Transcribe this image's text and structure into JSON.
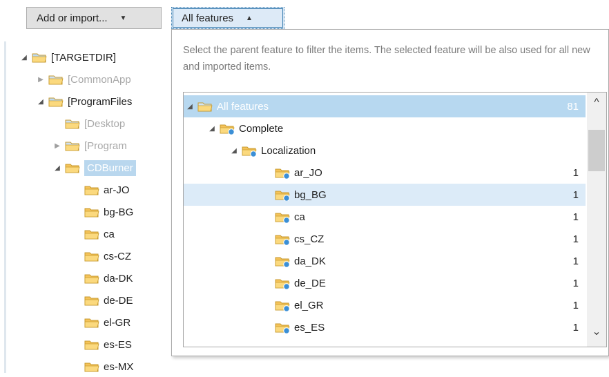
{
  "toolbar": {
    "add_label": "Add or import...",
    "add_caret": "▼",
    "features_label": "All features",
    "features_caret": "▲"
  },
  "left_tree": [
    {
      "label": "[TARGETDIR]",
      "depth": 0,
      "toggle": "◢",
      "style": "normal"
    },
    {
      "label": "[CommonApp",
      "depth": 1,
      "toggle": "▶",
      "style": "grey"
    },
    {
      "label": "[ProgramFiles",
      "depth": 1,
      "toggle": "◢",
      "style": "normal"
    },
    {
      "label": "[Desktop",
      "depth": 2,
      "toggle": "",
      "style": "grey"
    },
    {
      "label": "[Program",
      "depth": 2,
      "toggle": "▶",
      "style": "grey"
    },
    {
      "label": "CDBurner",
      "depth": 2,
      "toggle": "◢",
      "style": "selected"
    },
    {
      "label": "ar-JO",
      "depth": 3,
      "toggle": "",
      "style": "normal"
    },
    {
      "label": "bg-BG",
      "depth": 3,
      "toggle": "",
      "style": "normal"
    },
    {
      "label": "ca",
      "depth": 3,
      "toggle": "",
      "style": "normal"
    },
    {
      "label": "cs-CZ",
      "depth": 3,
      "toggle": "",
      "style": "normal"
    },
    {
      "label": "da-DK",
      "depth": 3,
      "toggle": "",
      "style": "normal"
    },
    {
      "label": "de-DE",
      "depth": 3,
      "toggle": "",
      "style": "normal"
    },
    {
      "label": "el-GR",
      "depth": 3,
      "toggle": "",
      "style": "normal"
    },
    {
      "label": "es-ES",
      "depth": 3,
      "toggle": "",
      "style": "normal"
    },
    {
      "label": "es-MX",
      "depth": 3,
      "toggle": "",
      "style": "normal"
    }
  ],
  "popup": {
    "hint": "Select the parent feature to filter the items. The selected feature will be also used for all new and imported items.",
    "features": [
      {
        "label": "All features",
        "count": "81",
        "depth": 0,
        "toggle": "◢",
        "state": "highlight"
      },
      {
        "label": "Complete",
        "count": "",
        "depth": 1,
        "toggle": "◢",
        "state": "normal"
      },
      {
        "label": "Localization",
        "count": "",
        "depth": 2,
        "toggle": "◢",
        "state": "normal"
      },
      {
        "label": "ar_JO",
        "count": "1",
        "depth": 3,
        "toggle": "",
        "state": "normal"
      },
      {
        "label": "bg_BG",
        "count": "1",
        "depth": 3,
        "toggle": "",
        "state": "selected"
      },
      {
        "label": "ca",
        "count": "1",
        "depth": 3,
        "toggle": "",
        "state": "normal"
      },
      {
        "label": "cs_CZ",
        "count": "1",
        "depth": 3,
        "toggle": "",
        "state": "normal"
      },
      {
        "label": "da_DK",
        "count": "1",
        "depth": 3,
        "toggle": "",
        "state": "normal"
      },
      {
        "label": "de_DE",
        "count": "1",
        "depth": 3,
        "toggle": "",
        "state": "normal"
      },
      {
        "label": "el_GR",
        "count": "1",
        "depth": 3,
        "toggle": "",
        "state": "normal"
      },
      {
        "label": "es_ES",
        "count": "1",
        "depth": 3,
        "toggle": "",
        "state": "normal"
      }
    ],
    "scroll_up": "^",
    "scroll_down": "⌄"
  },
  "colors": {
    "accent": "#3c7fb1",
    "highlight": "#b7d8f0",
    "selected": "#dcebf8",
    "folder": "#f5c35a"
  },
  "icons": {
    "folder": "folder-icon",
    "feature": "feature-folder-icon",
    "expand": "expand-arrow-icon",
    "collapse": "collapse-arrow-icon"
  }
}
